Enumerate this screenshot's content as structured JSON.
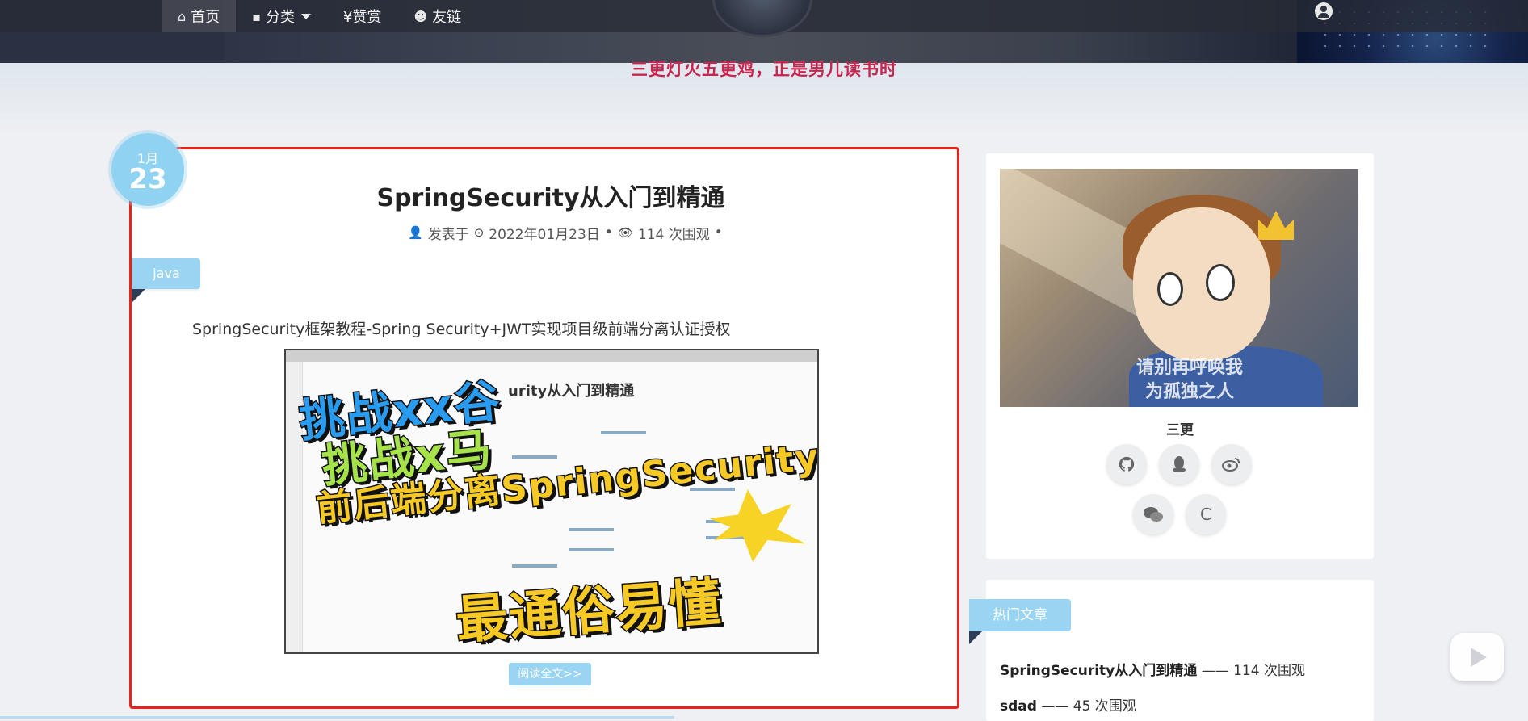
{
  "nav": {
    "items": [
      {
        "icon": "home-icon",
        "glyph": "⌂",
        "label": "首页"
      },
      {
        "icon": "folder-icon",
        "glyph": "▪",
        "label": "分类"
      },
      {
        "icon": "yen-icon",
        "glyph": "",
        "label": "¥赞赏"
      },
      {
        "icon": "users-icon",
        "glyph": "☻",
        "label": "友链"
      }
    ]
  },
  "site": {
    "motto": "三更灯火五更鸡，正是男儿读书时"
  },
  "article": {
    "date_month": "1月",
    "date_day": "23",
    "title": "SpringSecurity从入门到精通",
    "meta": {
      "posted_label": "发表于",
      "date": "2022年01月23日",
      "views": "114 次围观"
    },
    "tag": "java",
    "summary": "SpringSecurity框架教程-Spring Security+JWT实现项目级前端分离认证授权",
    "cover": {
      "subtitle": "urity从入门到精通",
      "line1": "挑战xx谷",
      "line2": "挑战x马",
      "line3": "前后端分离SpringSecurity",
      "line4": "最通俗易懂"
    },
    "read_more": "阅读全文>>"
  },
  "profile": {
    "caption_line1": "请别再呼唤我",
    "caption_line2": "为孤独之人",
    "name": "三更",
    "socials": [
      "github-icon",
      "qq-icon",
      "weibo-icon",
      "wechat-icon",
      "csdn-icon"
    ],
    "csdn_letter": "C"
  },
  "hot": {
    "title": "热门文章",
    "items": [
      {
        "title": "SpringSecurity从入门到精通",
        "views": "—— 114 次围观"
      },
      {
        "title": "sdad",
        "views": "—— 45 次围观"
      }
    ]
  }
}
